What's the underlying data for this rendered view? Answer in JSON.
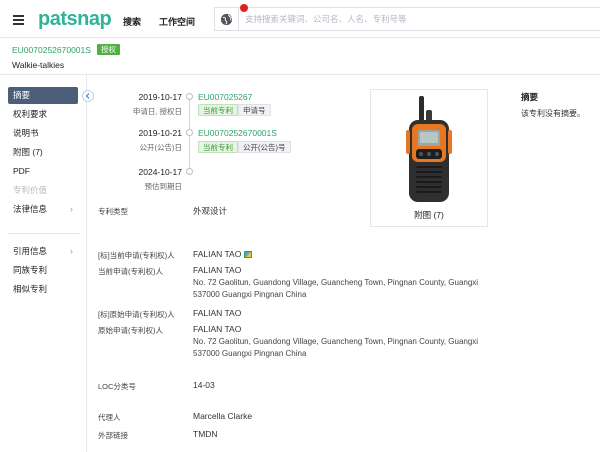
{
  "header": {
    "logo": "patsnap",
    "nav": [
      "搜索",
      "工作空间"
    ],
    "search_placeholder": "支持搜索关键词、公司名、人名、专利号等"
  },
  "patent": {
    "pub_number": "EU007025267000​1S",
    "status_badge": "授权",
    "title": "Walkie-talkies"
  },
  "sidebar": {
    "items": [
      {
        "label": "摘要"
      },
      {
        "label": "权利要求"
      },
      {
        "label": "说明书"
      },
      {
        "label": "附图 (7)"
      },
      {
        "label": "PDF"
      },
      {
        "label": "专利价值"
      },
      {
        "label": "法律信息"
      },
      {
        "label": "引用信息"
      },
      {
        "label": "同族专利"
      },
      {
        "label": "相似专利"
      }
    ]
  },
  "timeline": [
    {
      "date": "2019-10-17",
      "sub": "申请日, 授权日",
      "number": "EU007025267",
      "tags": [
        "当前专利",
        "申请号"
      ]
    },
    {
      "date": "2019-10-21",
      "sub": "公开(公告)日",
      "number": "EU0070252670001S",
      "tags": [
        "当前专利",
        "公开(公告)号"
      ]
    },
    {
      "date": "2024-10-17",
      "sub": "预估到期日"
    }
  ],
  "figure": {
    "caption": "附图 (7)"
  },
  "abstract": {
    "title": "摘要",
    "text": "该专利没有摘要。"
  },
  "fields": {
    "patent_type": {
      "label": "专利类型",
      "value": "外观设计"
    },
    "std_current_assignee": {
      "label": "[标]当前申请(专利权)人",
      "value": "FALIAN TAO"
    },
    "current_assignee": {
      "label": "当前申请(专利权)人",
      "value": "FALIAN TAO",
      "addr1": "No. 72 Gaolitun, Guandong Village, Guancheng Town, Pingnan County, Guangxi",
      "addr2": "537000 Guangxi Pingnan China"
    },
    "std_original_assignee": {
      "label": "[标]原始申请(专利权)人",
      "value": "FALIAN TAO"
    },
    "original_assignee": {
      "label": "原始申请(专利权)人",
      "value": "FALIAN TAO",
      "addr1": "No. 72 Gaolitun, Guandong Village, Guancheng Town, Pingnan County, Guangxi",
      "addr2": "537000 Guangxi Pingnan China"
    },
    "loc": {
      "label": "LOC分类号",
      "value": "14-03"
    },
    "agent": {
      "label": "代理人",
      "value": "Marcella Clarke"
    },
    "external_link": {
      "label": "外部链接",
      "value": "TMDN"
    }
  },
  "colors": {
    "brand": "#2fb39a",
    "active_nav": "#4b5e7a",
    "link": "#2a7fd4",
    "granted": "#52b043"
  }
}
